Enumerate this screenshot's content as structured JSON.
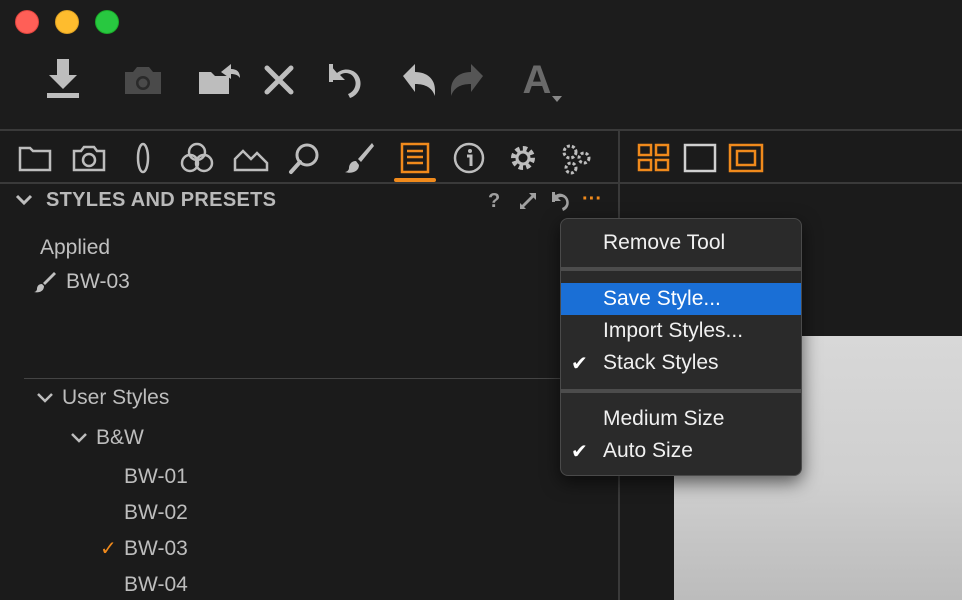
{
  "window": {
    "controls": [
      "close",
      "minimize",
      "zoom"
    ]
  },
  "toolbar": {
    "buttons": [
      {
        "name": "import-icon"
      },
      {
        "name": "camera-capture-icon"
      },
      {
        "name": "move-to-folder-icon"
      },
      {
        "name": "delete-icon"
      },
      {
        "name": "reset-icon"
      },
      {
        "name": "undo-icon"
      },
      {
        "name": "redo-icon"
      },
      {
        "name": "text-annotation-icon"
      }
    ],
    "text_tool_glyph": "A"
  },
  "tool_tabs": [
    {
      "name": "library",
      "active": false
    },
    {
      "name": "capture",
      "active": false
    },
    {
      "name": "lens",
      "active": false
    },
    {
      "name": "color",
      "active": false
    },
    {
      "name": "exposure",
      "active": false
    },
    {
      "name": "details",
      "active": false
    },
    {
      "name": "local-adjustments",
      "active": false
    },
    {
      "name": "adjustments",
      "active": true
    },
    {
      "name": "metadata",
      "active": false
    },
    {
      "name": "output",
      "active": false
    },
    {
      "name": "batch",
      "active": false
    }
  ],
  "viewer_modes": [
    "multi-view",
    "single-view",
    "proof-view"
  ],
  "panel": {
    "title": "STYLES AND PRESETS",
    "help_glyph": "?",
    "more_glyph": "···"
  },
  "applied": {
    "label": "Applied",
    "item": "BW-03"
  },
  "tree": {
    "user_styles": "User Styles",
    "group": "B&W",
    "items": [
      {
        "label": "BW-01",
        "checked": false
      },
      {
        "label": "BW-02",
        "checked": false
      },
      {
        "label": "BW-03",
        "checked": true
      },
      {
        "label": "BW-04",
        "checked": false
      }
    ],
    "check_glyph": "✓"
  },
  "menu": {
    "remove_tool": "Remove Tool",
    "save_style": "Save Style...",
    "import_styles": "Import Styles...",
    "stack_styles": "Stack Styles",
    "medium_size": "Medium Size",
    "auto_size": "Auto Size",
    "check_glyph": "✔"
  },
  "colors": {
    "accent": "#f08a1c",
    "menu_highlight": "#1a6fd6",
    "background": "#1b1b1b"
  }
}
